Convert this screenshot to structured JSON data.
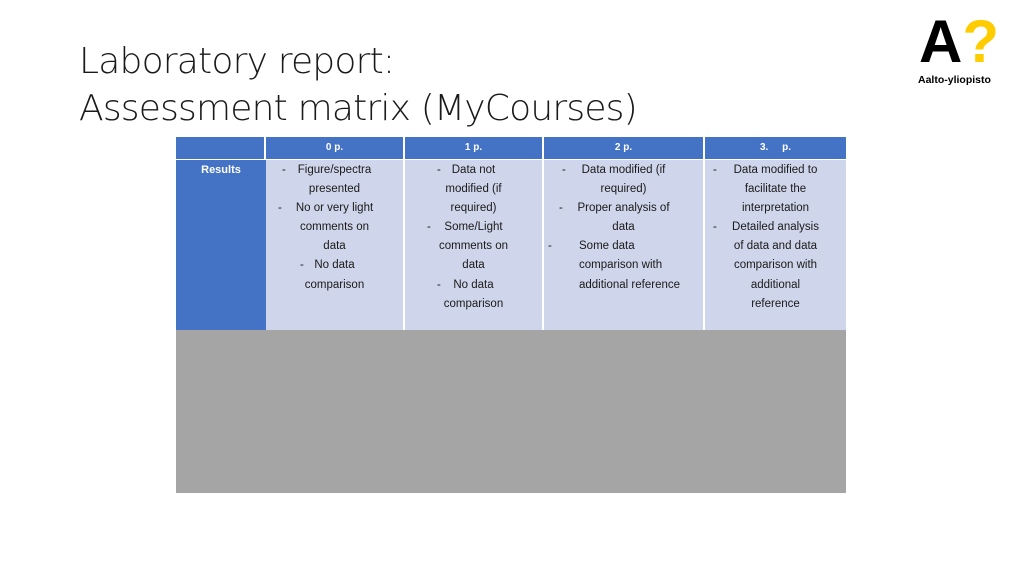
{
  "slide": {
    "title_line1": "Laboratory report:",
    "title_line2": "Assessment matrix (MyCourses)"
  },
  "logo": {
    "mark_a": "A",
    "mark_q": "?",
    "text": "Aalto-yliopisto",
    "colors": {
      "a": "#000000",
      "q": "#ffcc00"
    }
  },
  "matrix": {
    "header": [
      "",
      "0 p.",
      "1 p.",
      "2 p.",
      "3.     p."
    ],
    "row_label": "Results",
    "columns": [
      {
        "lines": [
          {
            "dash": "-",
            "text": "Figure/spectra"
          },
          {
            "dash": "",
            "text": "presented"
          },
          {
            "dash": "-",
            "text": "No or very light"
          },
          {
            "dash": "",
            "text": "comments on"
          },
          {
            "dash": "",
            "text": "data"
          },
          {
            "dash": "-",
            "text": "No data"
          },
          {
            "dash": "",
            "text": "comparison"
          }
        ]
      },
      {
        "lines": [
          {
            "dash": "-",
            "text": "Data not"
          },
          {
            "dash": "",
            "text": "modified (if"
          },
          {
            "dash": "",
            "text": "required)"
          },
          {
            "dash": "-",
            "text": "Some/Light"
          },
          {
            "dash": "",
            "text": "comments on"
          },
          {
            "dash": "",
            "text": "data"
          },
          {
            "dash": "-",
            "text": "No data"
          },
          {
            "dash": "",
            "text": "comparison"
          }
        ]
      },
      {
        "lines": [
          {
            "dash": "-",
            "text": "Data modified (if"
          },
          {
            "dash": "",
            "text": "required)"
          },
          {
            "dash": "-",
            "text": "Proper analysis of"
          },
          {
            "dash": "",
            "text": "data"
          },
          {
            "dash": "-",
            "text": "Some data"
          },
          {
            "dash": "",
            "text": "comparison with"
          },
          {
            "dash": "",
            "text": "additional reference"
          }
        ]
      },
      {
        "lines": [
          {
            "dash": "-",
            "text": "Data modified to"
          },
          {
            "dash": "",
            "text": "facilitate the"
          },
          {
            "dash": "",
            "text": "interpretation"
          },
          {
            "dash": "-",
            "text": "Detailed analysis"
          },
          {
            "dash": "",
            "text": "of data and data"
          },
          {
            "dash": "",
            "text": "comparison with"
          },
          {
            "dash": "",
            "text": "additional"
          },
          {
            "dash": "",
            "text": "reference"
          }
        ]
      }
    ],
    "colors": {
      "header": "#4472c4",
      "cell": "#cfd5ea",
      "overlay": "#a5a5a5"
    }
  }
}
